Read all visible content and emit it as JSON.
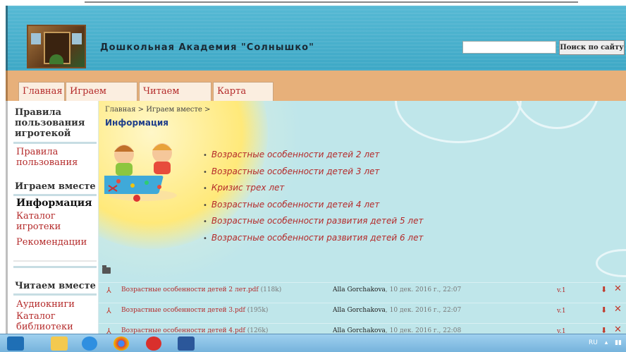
{
  "header": {
    "site_title": "Дошкольная Академия \"Солнышко\"",
    "search_placeholder": "",
    "search_button": "Поиск по сайту"
  },
  "nav": {
    "tabs": [
      "Главная",
      "Играем вместе",
      "Читаем вместе",
      "Карта сайта"
    ]
  },
  "sidebar": {
    "section1_title": "Правила пользования игротекой",
    "section1_items": [
      "Правила пользования"
    ],
    "section2_title": "Играем вместе",
    "section2_active": "Информация",
    "section2_items": [
      "Каталог игротеки",
      "Рекомендации"
    ],
    "section3_title": "Читаем вместе",
    "section3_items": [
      "Аудиокниги",
      "Каталог библиотеки"
    ]
  },
  "main": {
    "breadcrumb": "Главная > Играем вместе >",
    "title": "Информация",
    "articles": [
      "Возрастные особенности детей 2 лет",
      "Возрастные особенности детей 3 лет",
      "Кризис трех лет",
      "Возрастные особенности детей 4 лет",
      "Возрастные особенности развития детей 5 лет",
      "Возрастные особенности развития детей 6 лет"
    ],
    "files": [
      {
        "name": "Возрастные особенности детей 2 лет.pdf",
        "size": "(118k)",
        "author": "Alla Gorchakova",
        "date": ", 10 дек. 2016 г., 22:07",
        "version": "v.1"
      },
      {
        "name": "Возрастные особенности детей 3.pdf",
        "size": "(195k)",
        "author": "Alla Gorchakova",
        "date": ", 10 дек. 2016 г., 22:07",
        "version": "v.1"
      },
      {
        "name": "Возрастные особенности детей 4.pdf",
        "size": "(126k)",
        "author": "Alla Gorchakova",
        "date": ", 10 дек. 2016 г., 22:08",
        "version": "v.1"
      }
    ]
  },
  "taskbar": {
    "language": "RU"
  },
  "colors": {
    "header_blue": "#3ea8c6",
    "nav_orange": "#e7b07a",
    "link_red": "#b42a2a",
    "content_bg": "#bfe6ea"
  }
}
